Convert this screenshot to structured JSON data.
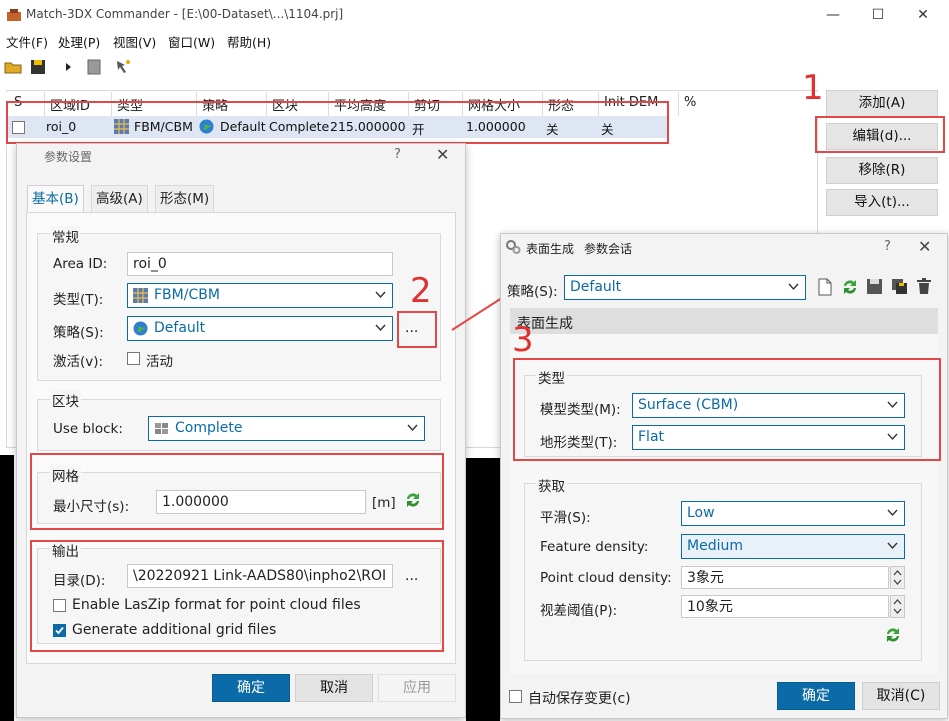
{
  "window": {
    "title": "Match-3DX Commander - [E:\\00-Dataset\\...\\1104.prj]",
    "minimize": "—",
    "maximize": "☐",
    "close": "✕"
  },
  "menu": {
    "file": "文件(F)",
    "process": "处理(P)",
    "view": "视图(V)",
    "window": "窗口(W)",
    "help": "帮助(H)"
  },
  "toolbar": {
    "icons": [
      "open-folder-icon",
      "save-icon",
      "play-icon",
      "stop-icon",
      "wizard-icon"
    ]
  },
  "grid": {
    "headers": [
      "S",
      "区域ID",
      "类型",
      "策略",
      "区块",
      "平均高度",
      "剪切",
      "网格大小",
      "形态",
      "Init DEM",
      "%"
    ],
    "rows": [
      {
        "s": "",
        "area_id": "roi_0",
        "type": "FBM/CBM",
        "strategy": "Default",
        "block": "Complete",
        "avg_height": "215.000000",
        "clip": "开",
        "grid_size": "1.000000",
        "morphology": "关",
        "init_dem": "关"
      }
    ]
  },
  "side_buttons": {
    "add": "添加(A)",
    "edit": "编辑(d)...",
    "remove": "移除(R)",
    "import": "导入(t)..."
  },
  "annotations": {
    "one": "1",
    "two": "2",
    "three": "3"
  },
  "param_dialog": {
    "title": "参数设置",
    "help": "?",
    "close": "✕",
    "tabs": [
      "基本(B)",
      "高级(A)",
      "形态(M)"
    ],
    "general": {
      "group": "常规",
      "area_id_label": "Area ID:",
      "area_id_value": "roi_0",
      "type_label": "类型(T):",
      "type_value": "FBM/CBM",
      "strategy_label": "策略(S):",
      "strategy_value": "Default",
      "strategy_more": "...",
      "active_label": "激活(v):",
      "active_checkbox": "活动"
    },
    "block": {
      "group": "区块",
      "use_block_label": "Use block:",
      "use_block_value": "Complete"
    },
    "mesh": {
      "group": "网格",
      "min_size_label": "最小尺寸(s):",
      "min_size_value": "1.000000",
      "unit": "[m]"
    },
    "output": {
      "group": "输出",
      "dir_label": "目录(D):",
      "dir_value": "\\20220921 Link-AADS80\\inpho2\\ROI",
      "dir_more": "...",
      "laszip": "Enable LasZip format for point cloud files",
      "laszip_checked": false,
      "grid_files": "Generate additional grid files",
      "grid_files_checked": true
    },
    "ok": "确定",
    "cancel": "取消",
    "apply": "应用"
  },
  "surface_dialog": {
    "title_main": "表面生成",
    "title_sub": "参数会话",
    "help": "?",
    "close": "✕",
    "strategy_label": "策略(S):",
    "strategy_value": "Default",
    "section": "表面生成",
    "type_group": {
      "group": "类型",
      "model_type_label": "模型类型(M):",
      "model_type_value": "Surface (CBM)",
      "terrain_type_label": "地形类型(T):",
      "terrain_type_value": "Flat"
    },
    "acquire_group": {
      "group": "获取",
      "smooth_label": "平滑(S):",
      "smooth_value": "Low",
      "feature_density_label": "Feature density:",
      "feature_density_value": "Medium",
      "point_cloud_label": "Point cloud density:",
      "point_cloud_value": "3象元",
      "parallax_label": "视差阈值(P):",
      "parallax_value": "10象元"
    },
    "autosave": "自动保存变更(c)",
    "ok": "确定",
    "cancel": "取消(C)"
  },
  "colors": {
    "accent": "#0b6aa8",
    "annotation_red": "#e34848",
    "selected_row": "#dde6f2"
  }
}
